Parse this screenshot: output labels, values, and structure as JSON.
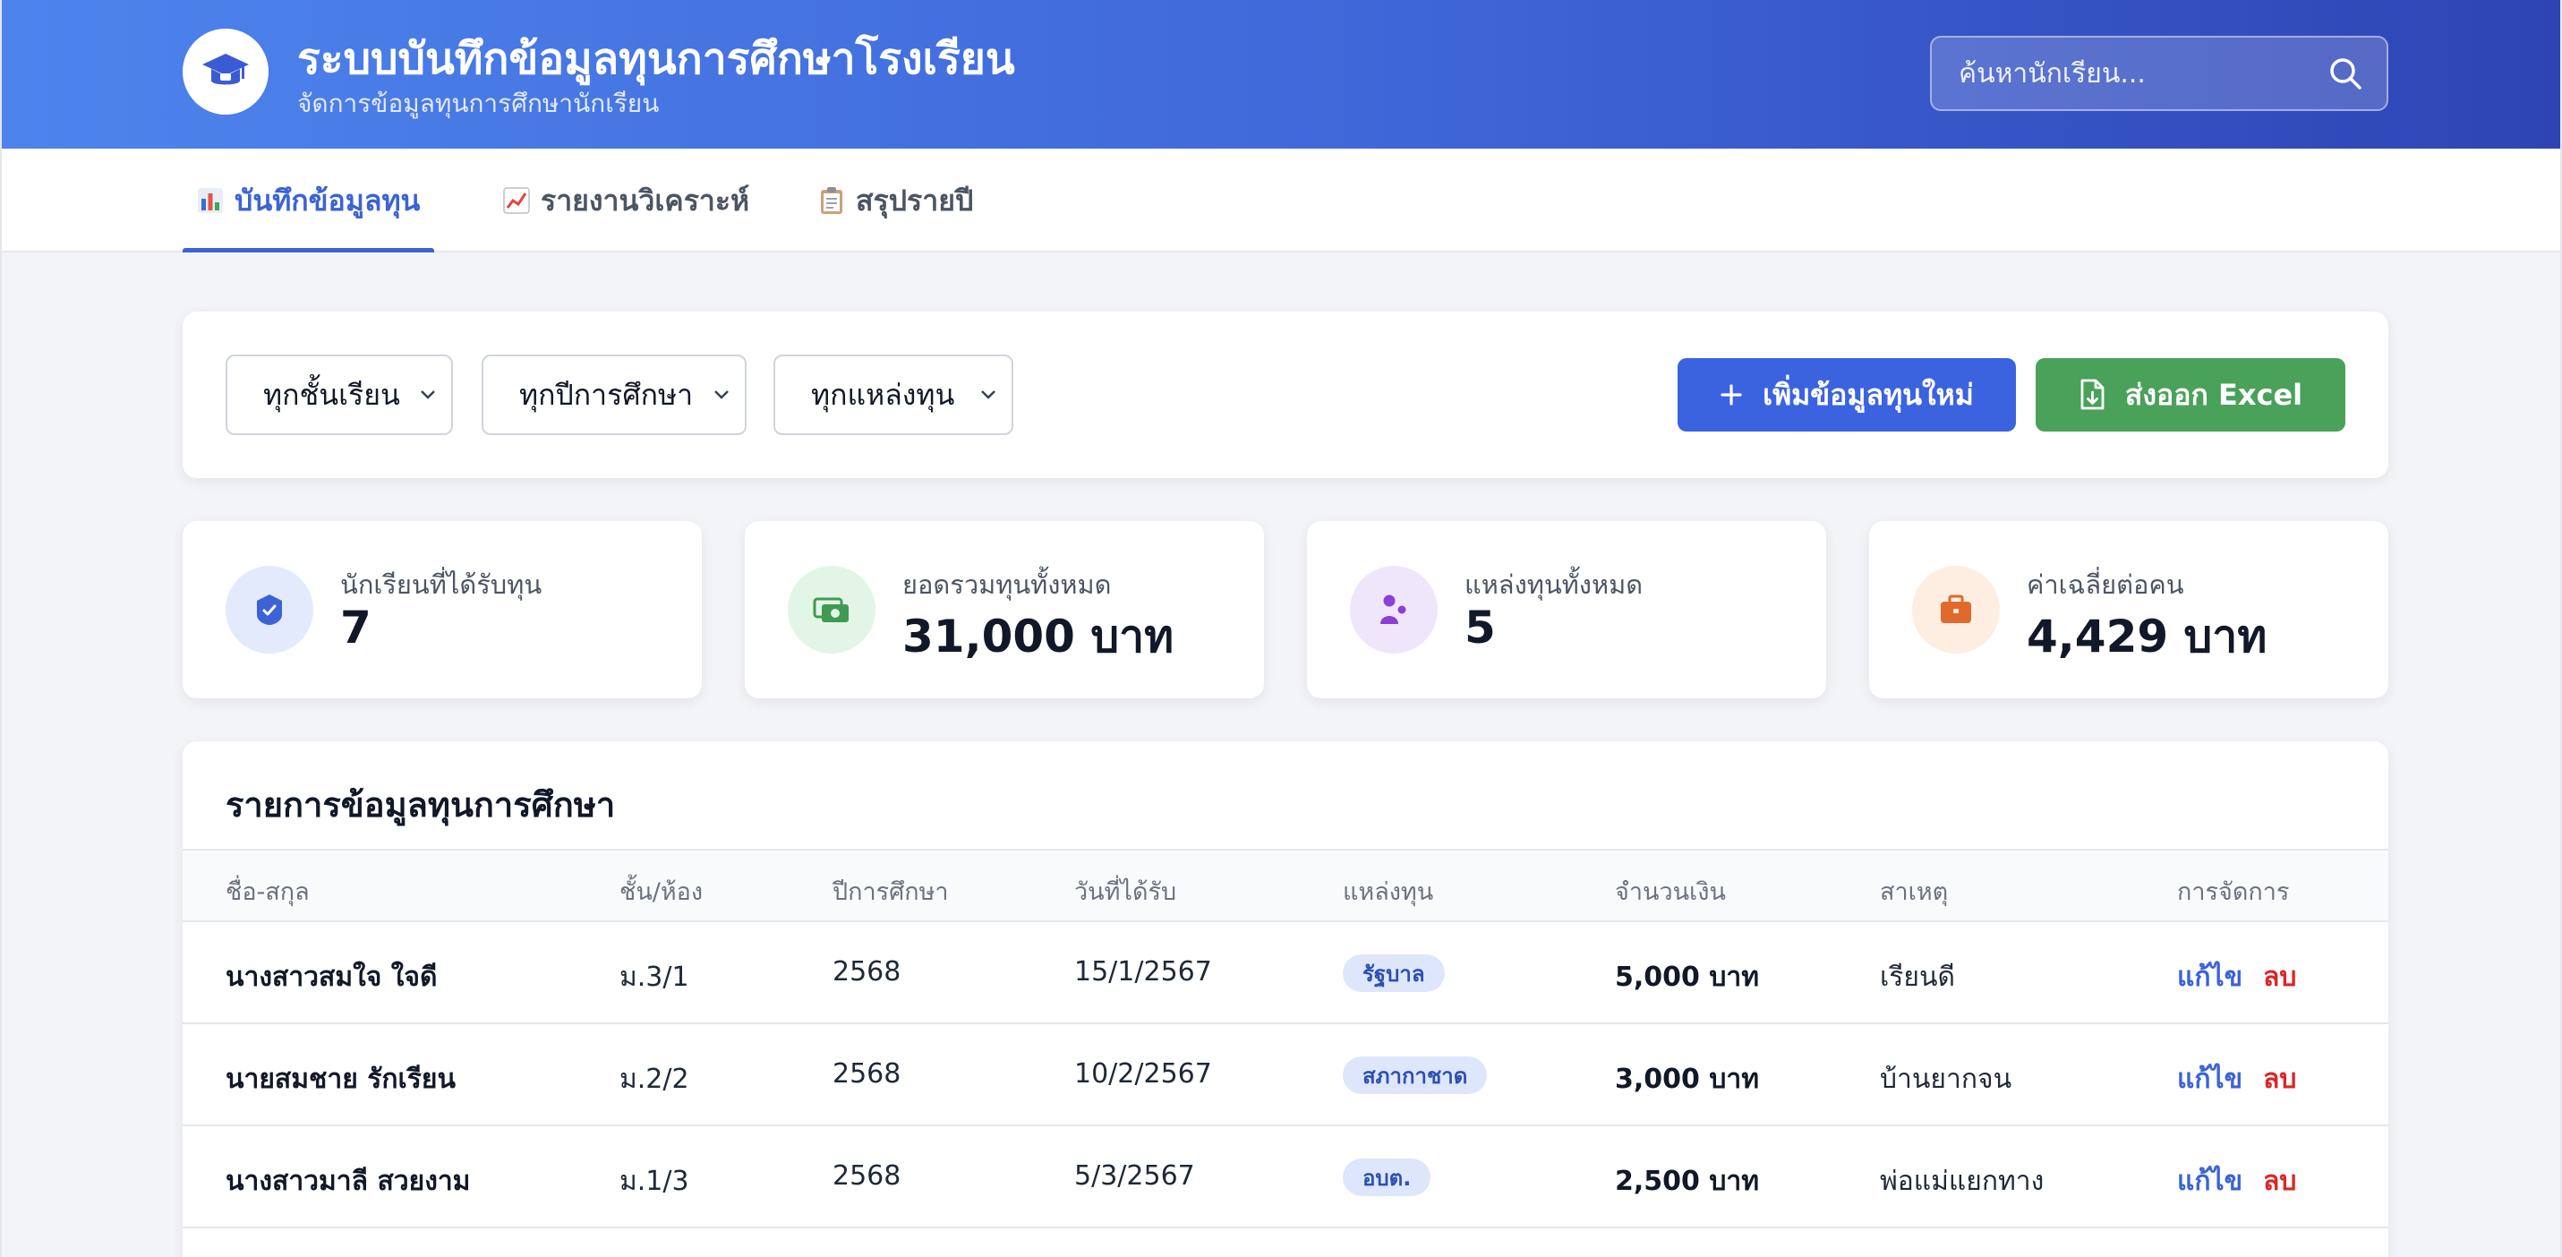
{
  "header": {
    "title": "ระบบบันทึกข้อมูลทุนการศึกษาโรงเรียน",
    "subtitle": "จัดการข้อมูลทุนการศึกษานักเรียน",
    "logo_icon": "graduation-cap-icon",
    "search": {
      "placeholder": "ค้นหานักเรียน...",
      "value": ""
    }
  },
  "tabs": [
    {
      "icon": "bar-chart-icon",
      "label": "บันทึกข้อมูลทุน",
      "active": true
    },
    {
      "icon": "line-chart-icon",
      "label": "รายงานวิเคราะห์",
      "active": false
    },
    {
      "icon": "clipboard-icon",
      "label": "สรุปรายปี",
      "active": false
    }
  ],
  "filters": {
    "class": "ทุกชั้นเรียน",
    "year": "ทุกปีการศึกษา",
    "source": "ทุกแหล่งทุน"
  },
  "actions": {
    "add_label": "เพิ่มข้อมูลทุนใหม่",
    "export_label": "ส่งออก Excel"
  },
  "stats": [
    {
      "icon": "badge-check-icon",
      "label": "นักเรียนที่ได้รับทุน",
      "value": "7",
      "color": "#3b63d6",
      "bg": "#e3eafc"
    },
    {
      "icon": "money-icon",
      "label": "ยอดรวมทุนทั้งหมด",
      "value": "31,000 บาท",
      "color": "#3f9b52",
      "bg": "#e3f5e6"
    },
    {
      "icon": "users-icon",
      "label": "แหล่งทุนทั้งหมด",
      "value": "5",
      "color": "#8b3fd6",
      "bg": "#f0e6fb"
    },
    {
      "icon": "briefcase-icon",
      "label": "ค่าเฉลี่ยต่อคน",
      "value": "4,429 บาท",
      "color": "#e06a2c",
      "bg": "#fdeee1"
    }
  ],
  "table": {
    "title": "รายการข้อมูลทุนการศึกษา",
    "columns": [
      "ชื่อ-สกุล",
      "ชั้น/ห้อง",
      "ปีการศึกษา",
      "วันที่ได้รับ",
      "แหล่งทุน",
      "จำนวนเงิน",
      "สาเหตุ",
      "การจัดการ"
    ],
    "rows": [
      {
        "name": "นางสาวสมใจ ใจดี",
        "class": "ม.3/1",
        "year": "2568",
        "date": "15/1/2567",
        "source": "รัฐบาล",
        "amount": "5,000 บาท",
        "reason": "เรียนดี"
      },
      {
        "name": "นายสมชาย รักเรียน",
        "class": "ม.2/2",
        "year": "2568",
        "date": "10/2/2567",
        "source": "สภากาชาด",
        "amount": "3,000 บาท",
        "reason": "บ้านยากจน"
      },
      {
        "name": "นางสาวมาลี สวยงาม",
        "class": "ม.1/3",
        "year": "2568",
        "date": "5/3/2567",
        "source": "อบต.",
        "amount": "2,500 บาท",
        "reason": "พ่อแม่แยกทาง"
      }
    ],
    "edit_label": "แก้ไข",
    "delete_label": "ลบ"
  }
}
